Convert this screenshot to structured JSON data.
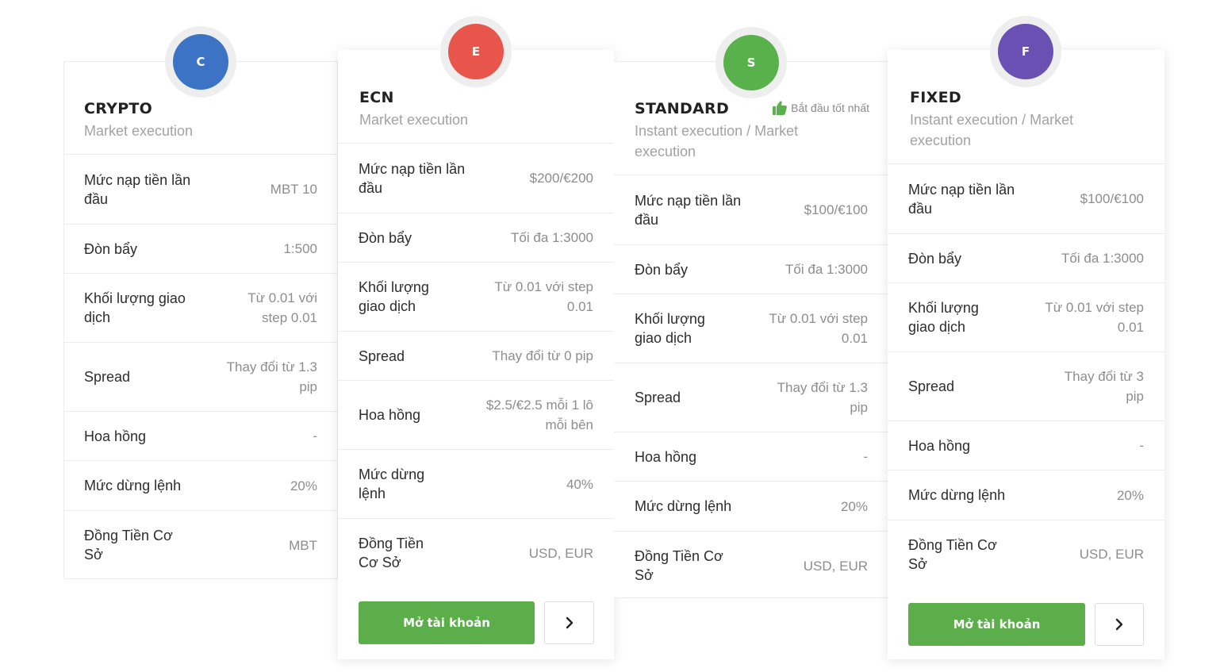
{
  "colors": {
    "crypto": "#3c73c4",
    "ecn": "#e8554b",
    "standard": "#59b14b",
    "fixed": "#6a50b2",
    "button": "#5cae4a"
  },
  "labels": {
    "deposit": "Mức nạp tiền lần đầu",
    "leverage": "Đòn bẩy",
    "volume": "Khối lượng giao dịch",
    "spread": "Spread",
    "commission": "Hoa hồng",
    "stopout": "Mức dừng lệnh",
    "currency": "Đồng Tiền Cơ Sở"
  },
  "cards": [
    {
      "initial": "C",
      "title": "CRYPTO",
      "subtitle": "Market execution",
      "values": {
        "deposit": "MBT 10",
        "leverage": "1:500",
        "volume": "Từ 0.01 với step 0.01",
        "spread": "Thay đổi từ 1.3 pip",
        "commission": "-",
        "stopout": "20%",
        "currency": "MBT"
      }
    },
    {
      "initial": "E",
      "title": "ECN",
      "subtitle": "Market execution",
      "values": {
        "deposit": "$200/€200",
        "leverage": "Tối đa 1:3000",
        "volume": "Từ 0.01 với step 0.01",
        "spread": "Thay đổi từ 0 pip",
        "commission": "$2.5/€2.5 mỗi 1 lô mỗi bên",
        "stopout": "40%",
        "currency": "USD, EUR"
      },
      "open_button": "Mở tài khoản"
    },
    {
      "initial": "S",
      "title": "STANDARD",
      "badge": "Bắt đầu tốt nhất",
      "subtitle": "Instant execution / Market execution",
      "values": {
        "deposit": "$100/€100",
        "leverage": "Tối đa 1:3000",
        "volume": "Từ 0.01 với step 0.01",
        "spread": "Thay đổi từ 1.3 pip",
        "commission": "-",
        "stopout": "20%",
        "currency": "USD, EUR"
      }
    },
    {
      "initial": "F",
      "title": "FIXED",
      "subtitle": "Instant execution / Market execution",
      "values": {
        "deposit": "$100/€100",
        "leverage": "Tối đa 1:3000",
        "volume": "Từ 0.01 với step 0.01",
        "spread": "Thay đổi từ 3 pip",
        "commission": "-",
        "stopout": "20%",
        "currency": "USD, EUR"
      },
      "open_button": "Mở tài khoản"
    }
  ]
}
